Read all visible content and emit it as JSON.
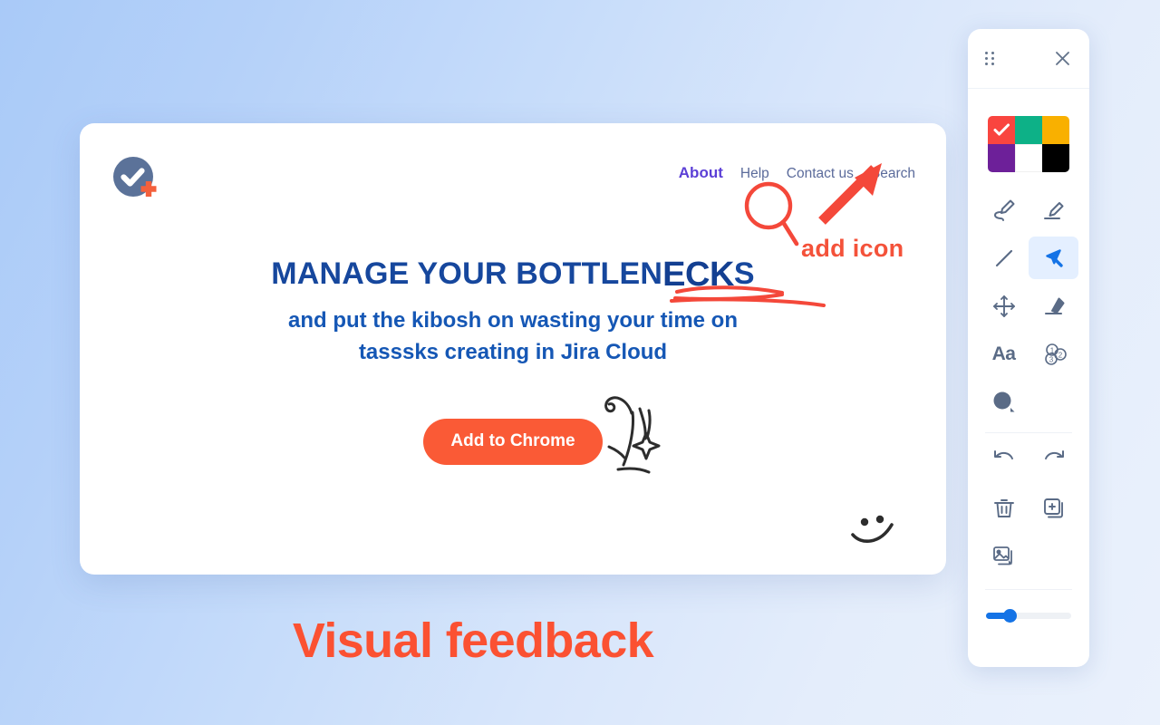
{
  "background": {
    "from": "#a9caf8",
    "to": "#eaf1fc"
  },
  "page_card": {
    "logo": {
      "name": "checkmark-plus-logo",
      "circle_color": "#5b7299",
      "check_color": "#ffffff",
      "plus_color": "#f4603c"
    },
    "nav": [
      {
        "label": "About",
        "active": true
      },
      {
        "label": "Help",
        "active": false
      },
      {
        "label": "Contact us",
        "active": false
      },
      {
        "label": "Search",
        "active": false
      }
    ],
    "headline_prefix": "MANAGE YOUR BOTTLEN",
    "headline_edited": "ECK",
    "headline_suffix": "S",
    "headline_color": "#16479d",
    "subheadline_line1": "and put the kibosh on wasting your time on",
    "subheadline_line2": "tasssks creating in Jira Cloud",
    "subheadline_color": "#1557b5",
    "cta_label": "Add to Chrome",
    "cta_color": "#fa5a36"
  },
  "annotations": {
    "label_text": "add icon",
    "label_color": "#f4523a",
    "stroke_color": "#f4483a",
    "magnifier": "magnifier-doodle",
    "arrow": "arrow-doodle",
    "underline": "scribble-underline-doodle",
    "burst": "burst-doodle",
    "smiley": "smiley-doodle"
  },
  "caption": {
    "text": "Visual feedback",
    "color": "#fb5132"
  },
  "tool_panel": {
    "drag_handle_name": "drag-handle",
    "close_label": "×",
    "swatches": [
      {
        "name": "red",
        "color": "#f9453f",
        "selected": true
      },
      {
        "name": "teal",
        "color": "#0db187",
        "selected": false
      },
      {
        "name": "amber",
        "color": "#f9b000",
        "selected": false
      },
      {
        "name": "purple",
        "color": "#6d2099",
        "selected": false
      },
      {
        "name": "white",
        "color": "#ffffff",
        "selected": false
      },
      {
        "name": "black",
        "color": "#000000",
        "selected": false
      }
    ],
    "tools": [
      {
        "name": "pen-tool",
        "selected": false
      },
      {
        "name": "highlighter-tool",
        "selected": false
      },
      {
        "name": "line-tool",
        "selected": false
      },
      {
        "name": "cursor-tool",
        "selected": true
      },
      {
        "name": "move-tool",
        "selected": false
      },
      {
        "name": "eraser-tool",
        "selected": false
      },
      {
        "name": "text-tool",
        "label": "Aa",
        "selected": false
      },
      {
        "name": "step-number-tool",
        "selected": false
      },
      {
        "name": "shape-tool",
        "selected": false
      }
    ],
    "actions": [
      {
        "name": "undo-action"
      },
      {
        "name": "redo-action"
      },
      {
        "name": "delete-action"
      },
      {
        "name": "add-page-action"
      },
      {
        "name": "image-action"
      }
    ],
    "slider": {
      "name": "thickness-slider",
      "value_percent": 28,
      "fill_color": "#1473e6",
      "track_color": "#eef1f5"
    }
  }
}
